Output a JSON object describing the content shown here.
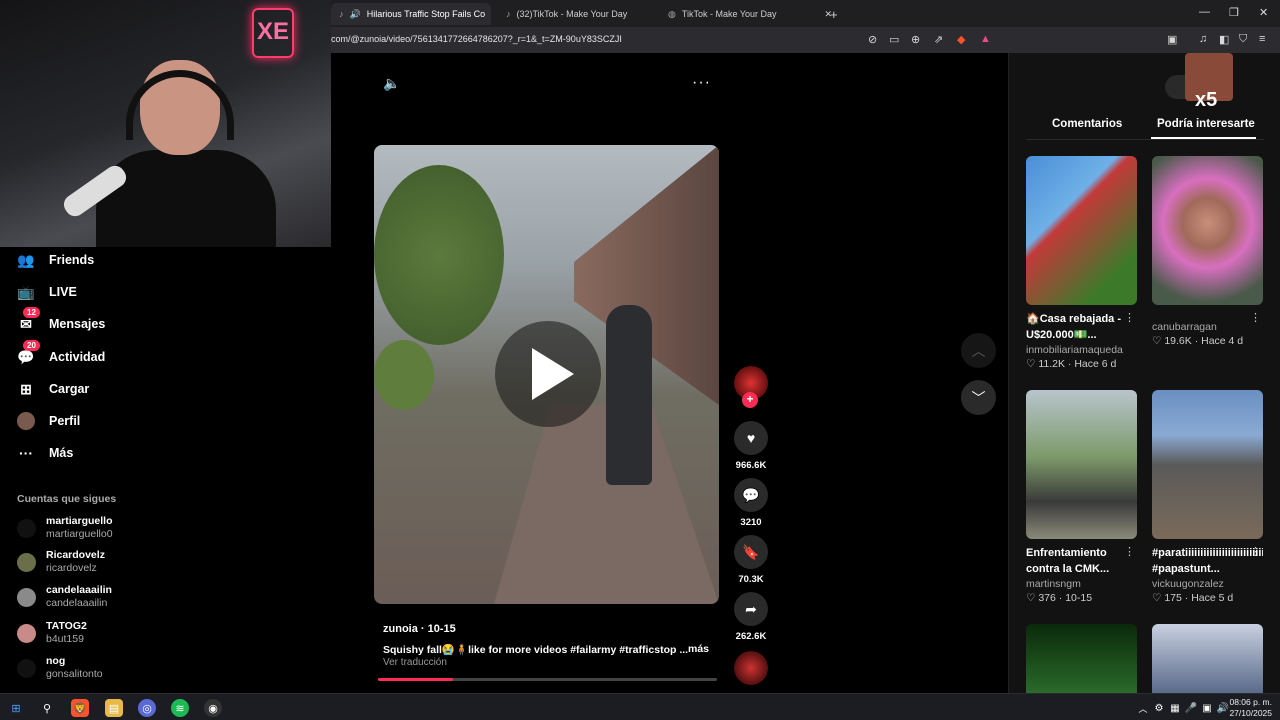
{
  "browser": {
    "tabs": [
      {
        "label": "Hilarious Traffic Stop Fails Co",
        "active": true
      },
      {
        "label": "(32)TikTok - Make Your Day",
        "active": false
      },
      {
        "label": "TikTok - Make Your Day",
        "active": false
      }
    ],
    "new_tab": "+",
    "url": "com/@zunoia/video/7561341772664786207?_r=1&_t=ZM-90uY83SCZJI"
  },
  "webcam": {
    "neon_text": "XE"
  },
  "nav": {
    "items": [
      {
        "label": "Friends",
        "icon": "friends-icon",
        "glyph": "👥"
      },
      {
        "label": "LIVE",
        "icon": "live-icon",
        "glyph": "📺"
      },
      {
        "label": "Mensajes",
        "icon": "messages-icon",
        "glyph": "✉",
        "badge": "12"
      },
      {
        "label": "Actividad",
        "icon": "activity-icon",
        "glyph": "💬",
        "badge": "20"
      },
      {
        "label": "Cargar",
        "icon": "upload-icon",
        "glyph": "⊞"
      },
      {
        "label": "Perfil",
        "icon": "profile-icon",
        "glyph": "●"
      },
      {
        "label": "Más",
        "icon": "more-icon",
        "glyph": "···"
      }
    ],
    "following_title": "Cuentas que sigues",
    "following": [
      {
        "name": "martiarguello",
        "user": "martiarguello0"
      },
      {
        "name": "Ricardovelz",
        "user": "ricardovelz"
      },
      {
        "name": "candelaaailin",
        "user": "candelaaailin"
      },
      {
        "name": "TATOG2",
        "user": "b4ut159"
      },
      {
        "name": "nog",
        "user": "gonsalitonto"
      }
    ]
  },
  "video": {
    "author": "zunoia · 10-15",
    "caption": "Squishy fall😭🧍like for more videos #failarmy  #trafficstop  ...",
    "more": "más",
    "translate": "Ver traducción",
    "progress": 0.22,
    "likes": "966.6K",
    "comments": "3210",
    "saves": "70.3K",
    "shares": "262.6K"
  },
  "right_panel": {
    "tabs": [
      "Comentarios",
      "Podría interesarte"
    ],
    "active_tab": "Podría interesarte",
    "overlay_text": "x5",
    "cards": [
      {
        "title": "🏠Casa rebajada - U$20.000💵...",
        "user": "inmobiliariamaqueda",
        "likes": "♡ 11.2K",
        "date": "Hace 6 d"
      },
      {
        "title": "",
        "user": "canubarragan",
        "likes": "♡ 19.6K",
        "date": "Hace 4 d"
      },
      {
        "title": "Enfrentamiento contra la CMK...",
        "user": "martinsngm",
        "likes": "♡ 376",
        "date": "10-15"
      },
      {
        "title": "#paratiiiiiiiiiiiiiiiiiiiiiiiiii #papastunt...",
        "user": "vickuugonzalez",
        "likes": "♡ 175",
        "date": "Hace 5 d"
      }
    ]
  },
  "taskbar": {
    "time": "08:06 p. m.",
    "date": "27/10/2025"
  },
  "colors": {
    "accent": "#fe2c55",
    "panel": "#121212"
  }
}
